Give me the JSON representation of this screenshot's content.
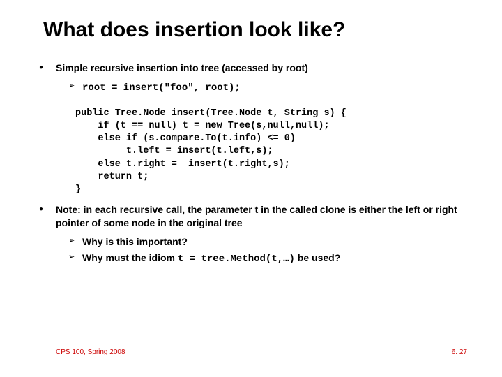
{
  "title": "What does insertion look like?",
  "bullets": {
    "b1": "Simple recursive insertion into tree (accessed by root)",
    "b1_sub_code": "root = insert(\"foo\", root);",
    "code_block": "public Tree.Node insert(Tree.Node t, String s) {\n    if (t == null) t = new Tree(s,null,null);\n    else if (s.compare.To(t.info) <= 0)\n         t.left = insert(t.left,s);\n    else t.right =  insert(t.right,s);\n    return t;\n}",
    "b2": "Note: in each recursive call, the parameter t in the called clone is either the left or right pointer of some node in the original tree",
    "b2_sub1": "Why is this important?",
    "b2_sub2_prefix": "Why must the idiom ",
    "b2_sub2_code": "t = tree.Method(t,…)",
    "b2_sub2_suffix": " be used?"
  },
  "footer": {
    "left": "CPS 100, Spring 2008",
    "right": "6. 27"
  }
}
